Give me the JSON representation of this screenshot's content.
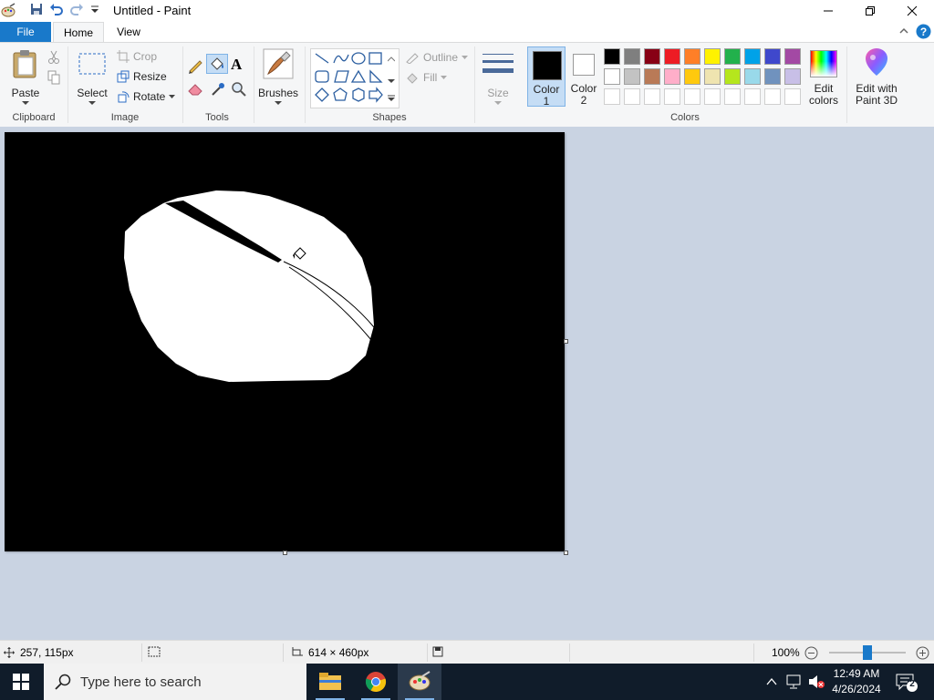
{
  "window": {
    "title": "Untitled - Paint"
  },
  "tabs": {
    "file": "File",
    "home": "Home",
    "view": "View"
  },
  "ribbon": {
    "clipboard": {
      "paste": "Paste",
      "label": "Clipboard"
    },
    "image": {
      "select": "Select",
      "crop": "Crop",
      "resize": "Resize",
      "rotate": "Rotate",
      "label": "Image"
    },
    "tools": {
      "label": "Tools"
    },
    "brushes": {
      "label": "Brushes"
    },
    "shapes": {
      "outline": "Outline",
      "fill": "Fill",
      "label": "Shapes"
    },
    "size": {
      "label": "Size"
    },
    "color1": {
      "line1": "Color",
      "line2": "1"
    },
    "color2": {
      "line1": "Color",
      "line2": "2"
    },
    "colors": {
      "label": "Colors",
      "edit_line1": "Edit",
      "edit_line2": "colors",
      "row1": [
        "#000000",
        "#7f7f7f",
        "#880015",
        "#ed1c24",
        "#ff7f27",
        "#fff200",
        "#22b14c",
        "#00a2e8",
        "#3f48cc",
        "#a349a4"
      ],
      "row2": [
        "#ffffff",
        "#c3c3c3",
        "#b97a57",
        "#ffaec9",
        "#ffc90e",
        "#efe4b0",
        "#b5e61d",
        "#99d9ea",
        "#7092be",
        "#c8bfe7"
      ],
      "row3": [
        "#ffffff",
        "#ffffff",
        "#ffffff",
        "#ffffff",
        "#ffffff",
        "#ffffff",
        "#ffffff",
        "#ffffff",
        "#ffffff",
        "#ffffff"
      ]
    },
    "paint3d": {
      "line1": "Edit with",
      "line2": "Paint 3D"
    }
  },
  "status": {
    "cursor_pos": "257, 115px",
    "canvas_size": "614 × 460px",
    "zoom": "100%",
    "zoom_level": 0.5
  },
  "taskbar": {
    "search_placeholder": "Type here to search",
    "time": "12:49 AM",
    "date": "4/26/2024",
    "notifications": "2"
  },
  "colors": {
    "accent": "#1979ca",
    "color1": "#000000",
    "color2": "#ffffff",
    "workspace": "#c9d3e2",
    "taskbar": "#101c2a"
  }
}
